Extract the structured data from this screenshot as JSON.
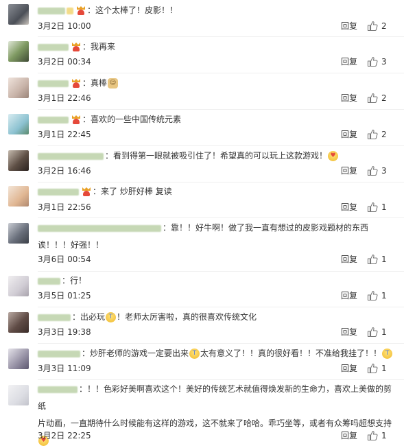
{
  "labels": {
    "reply": "回复"
  },
  "comments": [
    {
      "text": "：这个太棒了！皮影！！",
      "date": "3月2日 10:00",
      "likes": "2"
    },
    {
      "text": "：我再来",
      "date": "3月2日 00:34",
      "likes": "3"
    },
    {
      "text": "：真棒",
      "date": "3月1日 22:46",
      "likes": "2"
    },
    {
      "text": "：喜欢的一些中国传统元素",
      "date": "3月1日 22:45",
      "likes": "2"
    },
    {
      "text": "：看到得第一眼就被吸引住了！希望真的可以玩上这款游戏！",
      "date": "3月2日 16:46",
      "likes": "3"
    },
    {
      "text": "：来了 炒肝好棒 复读",
      "date": "3月1日 22:56",
      "likes": "1"
    },
    {
      "text_line1": "：靠！！好牛啊！做了我一直有想过的皮影戏题材的东西",
      "text_line2": "诶！！！好强！！",
      "date": "3月6日 00:54",
      "likes": "1"
    },
    {
      "text": "：行！",
      "date": "3月5日 01:25",
      "likes": "1"
    },
    {
      "text_a": "：出必玩",
      "text_b": "！老师太厉害啦，真的很喜欢传统文化",
      "date": "3月3日 19:38",
      "likes": "1"
    },
    {
      "text_a": "：炒肝老师的游戏一定要出来",
      "text_b": "太有意义了！！真的很好看！！不准给我挂了！！",
      "date": "3月3日 11:09",
      "likes": "1"
    },
    {
      "text_line1": "：！！色彩好美啊喜欢这个！美好的传统艺术就值得焕发新的生命力，喜欢上美做的剪纸",
      "text_line2": "片动画，一直期待什么时候能有这样的游戏，这不就来了哈哈。乖巧坐等，或者有众筹吗超想支持",
      "date": "3月2日 22:25",
      "likes": "1"
    }
  ]
}
